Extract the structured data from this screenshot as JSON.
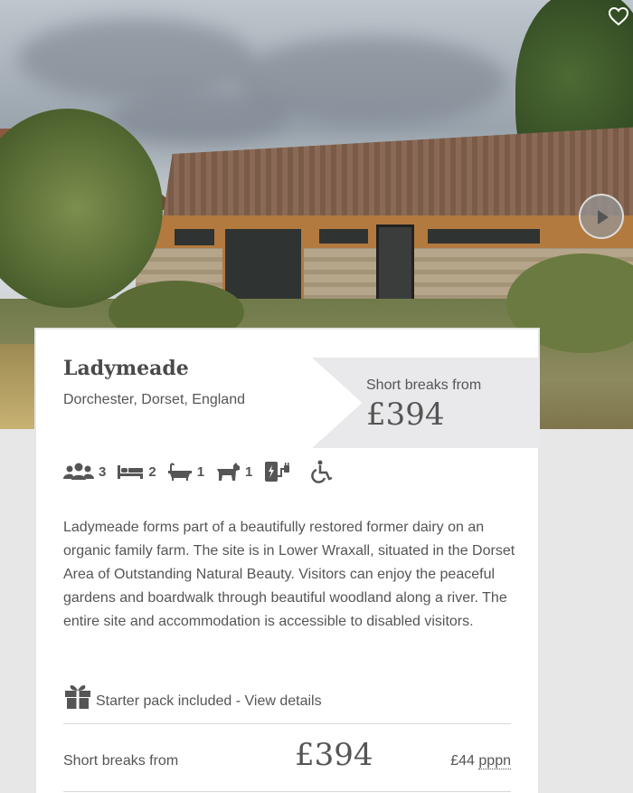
{
  "property": {
    "name": "Ladymeade",
    "location": "Dorchester, Dorset, England"
  },
  "price_tag": {
    "label": "Short breaks from",
    "price": "£394"
  },
  "features": [
    {
      "icon": "guests-icon",
      "value": "3"
    },
    {
      "icon": "bed-icon",
      "value": "2"
    },
    {
      "icon": "bath-icon",
      "value": "1"
    },
    {
      "icon": "dog-icon",
      "value": "1"
    },
    {
      "icon": "ev-charger-icon",
      "value": ""
    },
    {
      "icon": "wheelchair-icon",
      "value": ""
    }
  ],
  "description": "Ladymeade forms part of a beautifully restored former dairy on an organic family farm. The site is in Lower Wraxall, situated in the Dorset Area of Outstanding Natural Beauty. Visitors can enjoy the peaceful gardens and boardwalk through beautiful woodland along a river. The entire site and accommodation is accessible to disabled visitors.",
  "starter_pack": {
    "icon": "gift-icon",
    "text": "Starter pack included - View details"
  },
  "bottom_bar": {
    "label": "Short breaks from",
    "price": "£394",
    "per_night_amount": "£44",
    "per_night_unit": "pppn"
  },
  "colors": {
    "text": "#555555",
    "card_background": "#ffffff",
    "page_background": "#e7e7e8",
    "price_tag_background": "#e9e9eb"
  }
}
